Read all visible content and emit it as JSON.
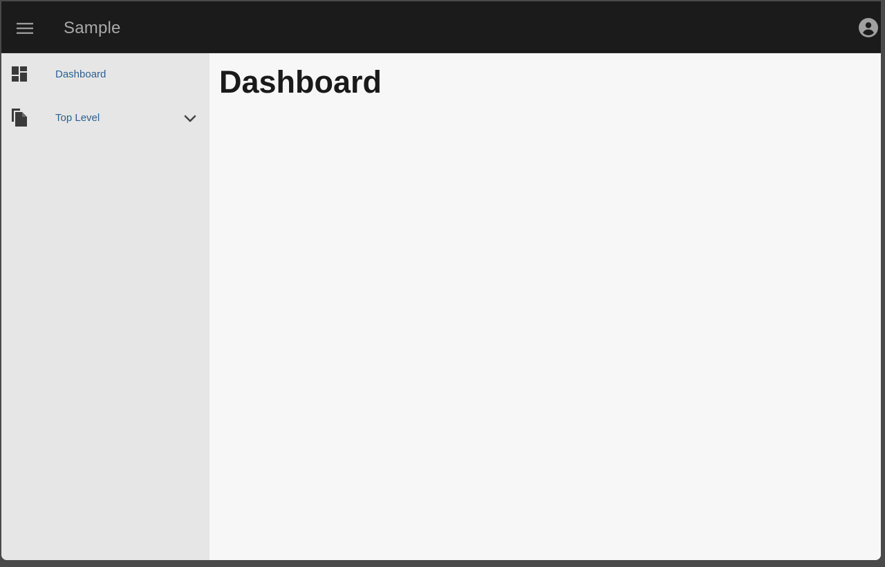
{
  "appbar": {
    "title": "Sample",
    "menu_icon": "menu-icon",
    "account_icon": "account-circle-icon"
  },
  "sidebar": {
    "items": [
      {
        "label": "Dashboard",
        "icon": "dashboard-icon"
      },
      {
        "label": "Top Level",
        "icon": "file-copy-icon",
        "expand_icon": "chevron-down-icon"
      }
    ]
  },
  "main": {
    "title": "Dashboard"
  },
  "colors": {
    "appbar_bg": "#1b1b1b",
    "sidebar_bg": "#e6e6e6",
    "link": "#2b5f93",
    "title_text": "#a9a9a9"
  }
}
